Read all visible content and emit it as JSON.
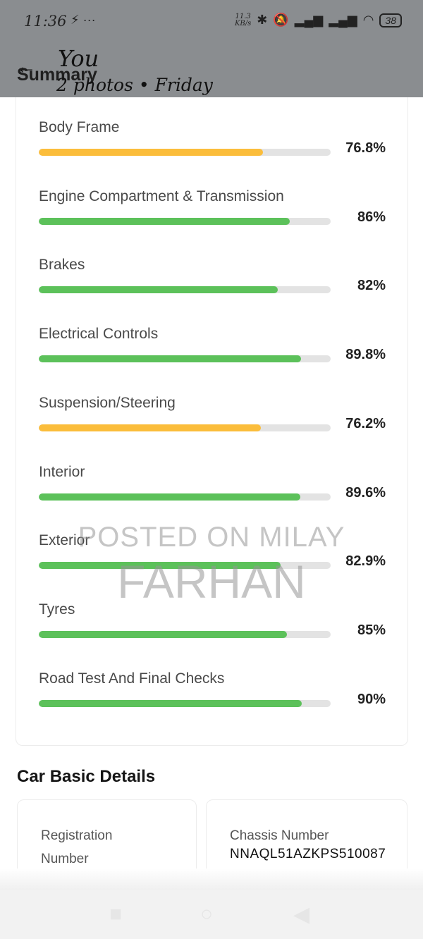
{
  "status_bar": {
    "time": "11:36",
    "left_icons": "⚡ ···",
    "net_speed_value": "11.3",
    "net_speed_unit": "KB/s",
    "battery": "38"
  },
  "header": {
    "title": "Summary",
    "gallery_title": "You",
    "gallery_subtitle": "2 photos  •  Friday"
  },
  "colors": {
    "green": "#5cc15a",
    "orange": "#fbbd3b",
    "track": "#e3e3e3"
  },
  "scores": [
    {
      "label": "Body Frame",
      "percent_text": "76.8%",
      "value": 76.8,
      "color": "orange"
    },
    {
      "label": "Engine Compartment & Transmission",
      "percent_text": "86%",
      "value": 86,
      "color": "green"
    },
    {
      "label": "Brakes",
      "percent_text": "82%",
      "value": 82,
      "color": "green"
    },
    {
      "label": "Electrical Controls",
      "percent_text": "89.8%",
      "value": 89.8,
      "color": "green"
    },
    {
      "label": "Suspension/Steering",
      "percent_text": "76.2%",
      "value": 76.2,
      "color": "orange"
    },
    {
      "label": "Interior",
      "percent_text": "89.6%",
      "value": 89.6,
      "color": "green"
    },
    {
      "label": "Exterior",
      "percent_text": "82.9%",
      "value": 82.9,
      "color": "green"
    },
    {
      "label": "Tyres",
      "percent_text": "85%",
      "value": 85,
      "color": "green"
    },
    {
      "label": "Road Test And Final Checks",
      "percent_text": "90%",
      "value": 90,
      "color": "green"
    }
  ],
  "watermark": {
    "line1": "POSTED ON MILAY",
    "line2": "FARHAN"
  },
  "car_basic_details": {
    "title": "Car Basic Details",
    "registration_label": "Registration Number",
    "chassis_label": "Chassis Number",
    "chassis_value": "NNAQL51AZKPS510087"
  }
}
